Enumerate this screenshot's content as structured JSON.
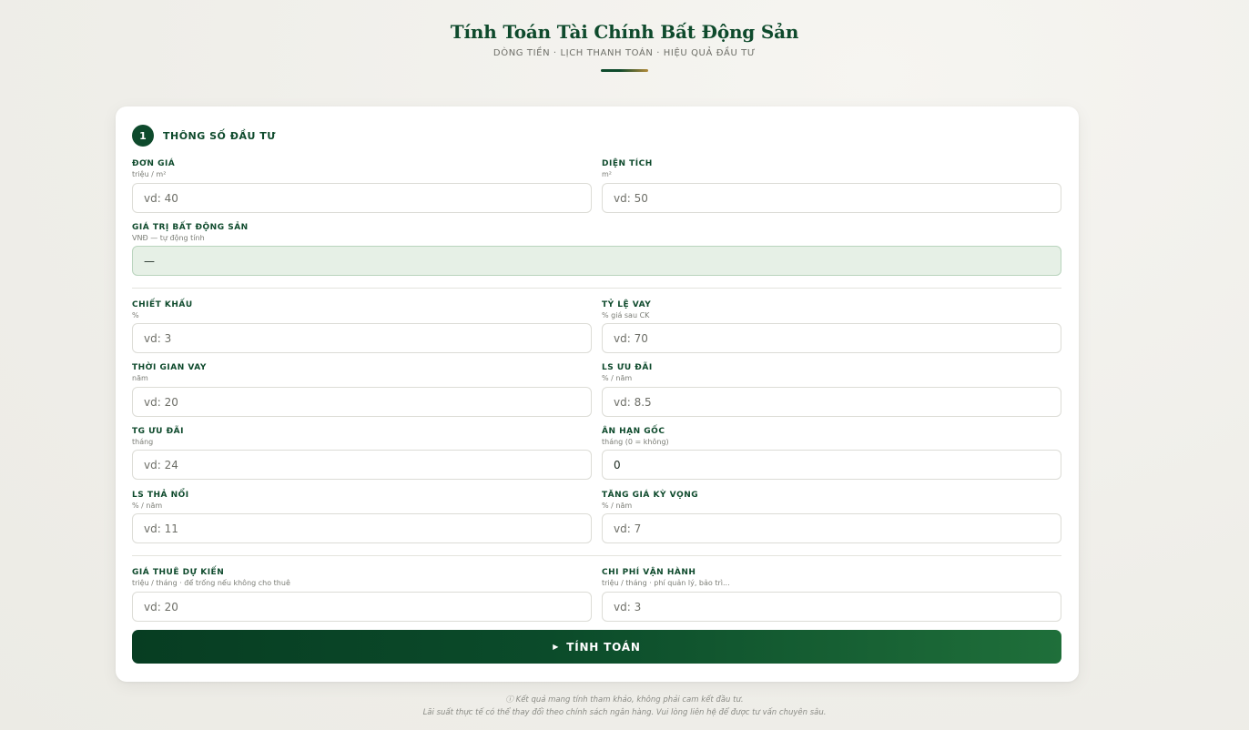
{
  "header": {
    "title": "Tính Toán Tài Chính Bất Động Sản",
    "subtitle": "DÒNG TIỀN · LỊCH THANH TOÁN · HIỆU QUẢ ĐẦU TƯ"
  },
  "section": {
    "step": "1",
    "title": "THÔNG SỐ ĐẦU TƯ"
  },
  "fields": {
    "don_gia": {
      "label": "ĐƠN GIÁ",
      "hint": "triệu / m²",
      "placeholder": "vd: 40"
    },
    "dien_tich": {
      "label": "DIỆN TÍCH",
      "hint": "m²",
      "placeholder": "vd: 50"
    },
    "gia_tri": {
      "label": "GIÁ TRỊ BẤT ĐỘNG SẢN",
      "hint": "VNĐ — tự động tính",
      "value": "—"
    },
    "chiet_khau": {
      "label": "CHIẾT KHẤU",
      "hint": "%",
      "placeholder": "vd: 3"
    },
    "ty_le_vay": {
      "label": "TỶ LỆ VAY",
      "hint": "% giá sau CK",
      "placeholder": "vd: 70"
    },
    "thoi_gian_vay": {
      "label": "THỜI GIAN VAY",
      "hint": "năm",
      "placeholder": "vd: 20"
    },
    "ls_uu_dai": {
      "label": "LS ƯU ĐÃI",
      "hint": "% / năm",
      "placeholder": "vd: 8.5"
    },
    "tg_uu_dai": {
      "label": "TG ƯU ĐÃI",
      "hint": "tháng",
      "placeholder": "vd: 24"
    },
    "an_han_goc": {
      "label": "ÂN HẠN GỐC",
      "hint": "tháng (0 = không)",
      "value": "0"
    },
    "ls_tha_noi": {
      "label": "LS THẢ NỔI",
      "hint": "% / năm",
      "placeholder": "vd: 11"
    },
    "tang_gia": {
      "label": "TĂNG GIÁ KỲ VỌNG",
      "hint": "% / năm",
      "placeholder": "vd: 7"
    },
    "gia_thue": {
      "label": "GIÁ THUÊ DỰ KIẾN",
      "hint": "triệu / tháng · để trống nếu không cho thuê",
      "placeholder": "vd: 20"
    },
    "chi_phi": {
      "label": "CHI PHÍ VẬN HÀNH",
      "hint": "triệu / tháng · phí quản lý, bảo trì...",
      "placeholder": "vd: 3"
    }
  },
  "button": {
    "icon": "▶",
    "label": "TÍNH TOÁN"
  },
  "footer": {
    "line1": "ⓘ Kết quả mang tính tham khảo, không phải cam kết đầu tư.",
    "line2": "Lãi suất thực tế có thể thay đổi theo chính sách ngân hàng. Vui lòng liên hệ để được tư vấn chuyên sâu."
  },
  "colors": {
    "brand": "#0e4a2c",
    "accent": "#b38a3a",
    "auto_field_bg": "#e6f0e6"
  }
}
